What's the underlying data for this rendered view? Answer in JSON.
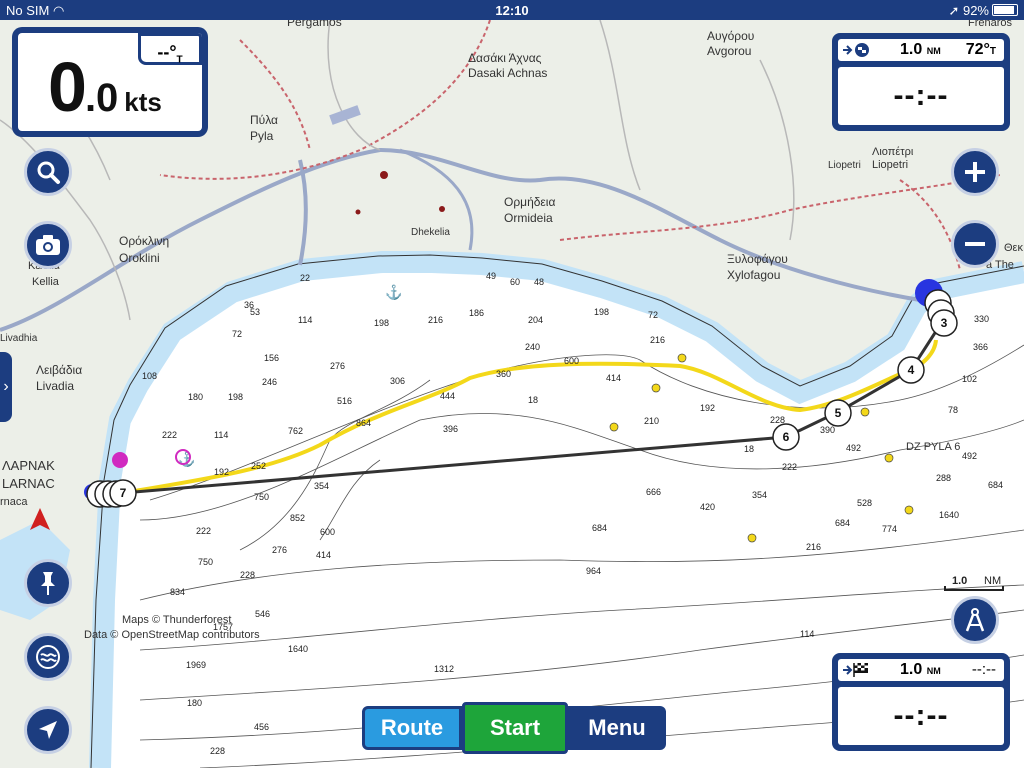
{
  "status_bar": {
    "carrier": "No SIM",
    "time": "12:10",
    "battery": "92%"
  },
  "speed_panel": {
    "speed_int": "0",
    "speed_dec": ".0",
    "unit": "kts",
    "heading": "--°",
    "heading_ref": "T"
  },
  "waypoint_panel_top": {
    "distance": "1.0",
    "distance_unit": "NM",
    "bearing": "72°",
    "bearing_ref": "T",
    "time_to_go": "--:--"
  },
  "destination_panel_bottom": {
    "distance": "1.0",
    "distance_unit": "NM",
    "eta": "--:--",
    "time_to_go": "--:--"
  },
  "toolbar": {
    "route_label": "Route",
    "start_label": "Start",
    "menu_label": "Menu"
  },
  "scale": {
    "value": "1.0",
    "unit": "NM"
  },
  "map": {
    "place_labels": [
      {
        "text": "Pergamos"
      },
      {
        "text": "Δασάκι Άχνας"
      },
      {
        "text": "Dasaki Achnas"
      },
      {
        "text": "Αυγόρου"
      },
      {
        "text": "Avgorou"
      },
      {
        "text": "Frenaros"
      },
      {
        "text": "Πύλα"
      },
      {
        "text": "Pyla"
      },
      {
        "text": "Λιοπέτρι"
      },
      {
        "text": "Liopetri"
      },
      {
        "text": "Liopetri"
      },
      {
        "text": "Ορμήδεια"
      },
      {
        "text": "Ormideia"
      },
      {
        "text": "Ορόκλινη"
      },
      {
        "text": "Oroklini"
      },
      {
        "text": "Dhekelia"
      },
      {
        "text": "Ξυλοφάγου"
      },
      {
        "text": "Xylofagou"
      },
      {
        "text": "Κελλια"
      },
      {
        "text": "Kellia"
      },
      {
        "text": "Livadhia"
      },
      {
        "text": "Λειβάδια"
      },
      {
        "text": "Livadia"
      },
      {
        "text": "ΛΑΡΝΑΚ"
      },
      {
        "text": "LARNAC"
      },
      {
        "text": "rnaca"
      },
      {
        "text": "DZ PYLA 6"
      },
      {
        "text": "Θεκ"
      },
      {
        "text": "a The"
      },
      {
        "text": "Maps © Thunderforest"
      },
      {
        "text": "Data © OpenStreetMap contributors"
      }
    ],
    "soundings": [
      "22",
      "36",
      "53",
      "72",
      "114",
      "198",
      "216",
      "186",
      "49",
      "60",
      "48",
      "198",
      "72",
      "204",
      "216",
      "156",
      "276",
      "240",
      "306",
      "516",
      "444",
      "360",
      "600",
      "414",
      "18",
      "108",
      "180",
      "198",
      "246",
      "762",
      "864",
      "396",
      "210",
      "192",
      "114",
      "222",
      "192",
      "252",
      "750",
      "354",
      "852",
      "600",
      "414",
      "276",
      "222",
      "750",
      "228",
      "834",
      "546",
      "1757",
      "1640",
      "456",
      "228",
      "180",
      "1969",
      "1312",
      "964",
      "684",
      "666",
      "420",
      "354",
      "222",
      "18",
      "228",
      "390",
      "492",
      "528",
      "684",
      "774",
      "1640",
      "216",
      "114",
      "78",
      "102",
      "330",
      "366",
      "492",
      "288",
      "684"
    ],
    "route_waypoints": [
      {
        "label": "3"
      },
      {
        "label": "4"
      },
      {
        "label": "5"
      },
      {
        "label": "6"
      },
      {
        "label": "7"
      }
    ],
    "colors": {
      "water": "#ffffff",
      "shallow": "#c3e3f7",
      "land": "#ecefe8",
      "route_line": "#333333",
      "track_line": "#f3d81a",
      "ui_navy": "#1c3d80",
      "start_green": "#1ea53a",
      "route_blue": "#2a9be0"
    }
  }
}
